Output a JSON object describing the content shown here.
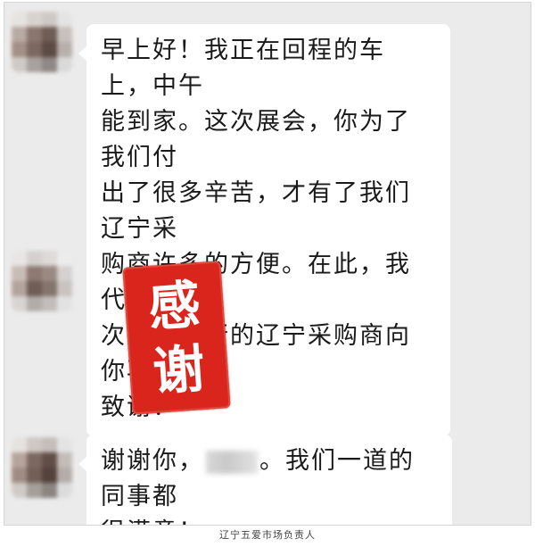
{
  "messages": [
    {
      "type": "text",
      "lines": [
        "早上好！我正在回程的车上，中午",
        "能到家。这次展会，你为了我们付",
        "出了很多辛苦，才有了我们辽宁采",
        "购商许多的方便。在此，我代表这",
        "次郑州之行的辽宁采购商向你再次",
        "致谢！"
      ]
    },
    {
      "type": "sticker",
      "chars": [
        "感",
        "谢"
      ],
      "color": "#d9251c"
    },
    {
      "type": "text",
      "line1_before": "谢谢你，",
      "line1_after": "。我们一道的同事都",
      "line2": "很满意！",
      "emoji": "clapping-hands-icon"
    }
  ],
  "caption": "辽宁五爱市场负责人",
  "colors": {
    "background": "#ebebeb",
    "bubble": "#ffffff",
    "stamp": "#d9251c"
  }
}
